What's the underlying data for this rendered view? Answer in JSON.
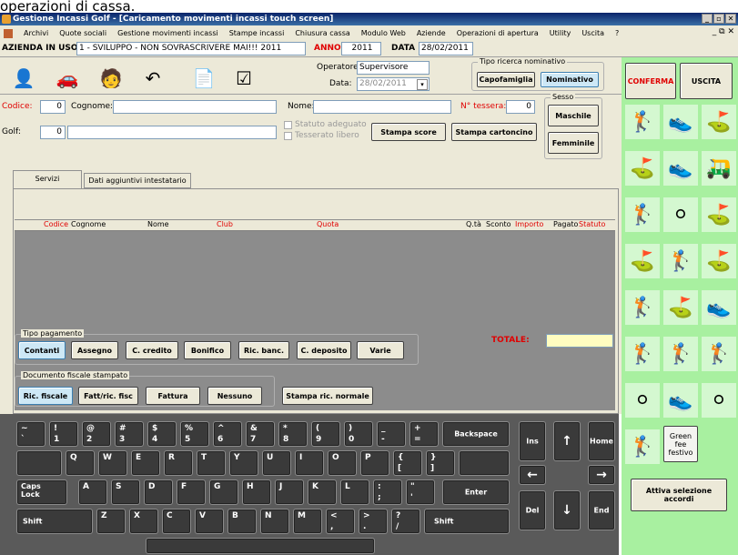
{
  "page_caption": "operazioni di cassa.",
  "window": {
    "title": "Gestione Incassi Golf - [Caricamento movimenti incassi touch screen]"
  },
  "menu": [
    "Archivi",
    "Quote sociali",
    "Gestione movimenti incassi",
    "Stampe incassi",
    "Chiusura cassa",
    "Modulo Web",
    "Aziende",
    "Operazioni di apertura",
    "Utility",
    "Uscita",
    "?"
  ],
  "azienda": {
    "label": "AZIENDA IN USO",
    "value": "1 - SVILUPPO - NON SOVRASCRIVERE MAI!!! 2011",
    "anno_label": "ANNO",
    "anno": "2011",
    "data_label": "DATA",
    "data": "28/02/2011"
  },
  "operatore": {
    "label": "Operatore:",
    "value": "Supervisore",
    "data_label": "Data:",
    "data_value": "28/02/2011"
  },
  "ricerca": {
    "title": "Tipo ricerca nominativo",
    "capofamiglia": "Capofamiglia",
    "nominativo": "Nominativo"
  },
  "actions": {
    "conferma": "CONFERMA",
    "uscita": "USCITA"
  },
  "form": {
    "codice_label": "Codice:",
    "codice": "0",
    "cognome_label": "Cognome:",
    "nome_label": "Nome:",
    "tessera_label": "N° tessera:",
    "tessera": "0",
    "golf_label": "Golf:",
    "golf": "0",
    "statuto": "Statuto adeguato",
    "tesserato": "Tesserato libero",
    "stampa_score": "Stampa score",
    "stampa_cartoncino": "Stampa cartoncino",
    "sesso_title": "Sesso",
    "maschile": "Maschile",
    "femminile": "Femminile"
  },
  "tabs": [
    "Servizi",
    "Dati aggiuntivi intestatario"
  ],
  "table": {
    "columns": [
      "Codice",
      "Cognome",
      "Nome",
      "Club",
      "Quota",
      "Q.tà",
      "Sconto",
      "Importo",
      "Pagato",
      "Statuto"
    ]
  },
  "pagamento": {
    "title": "Tipo pagamento",
    "items": [
      "Contanti",
      "Assegno",
      "C. credito",
      "Bonifico",
      "Ric. banc.",
      "C. deposito",
      "Varie"
    ],
    "totale_label": "TOTALE:"
  },
  "documento": {
    "title": "Documento fiscale stampato",
    "items": [
      "Ric. fiscale",
      "Fatt/ric. fisc",
      "Fattura",
      "Nessuno"
    ],
    "stampa": "Stampa ric. normale"
  },
  "keyboard": {
    "row1": [
      [
        "~",
        "`"
      ],
      [
        "!",
        "1"
      ],
      [
        "@",
        "2"
      ],
      [
        "#",
        "3"
      ],
      [
        "$",
        "4"
      ],
      [
        "%",
        "5"
      ],
      [
        "^",
        "6"
      ],
      [
        "&",
        "7"
      ],
      [
        "*",
        "8"
      ],
      [
        "(",
        "9"
      ],
      [
        ")",
        "0"
      ],
      [
        "_",
        "-"
      ],
      [
        "+",
        "="
      ]
    ],
    "row2": [
      "Q",
      "W",
      "E",
      "R",
      "T",
      "Y",
      "U",
      "I",
      "O",
      "P"
    ],
    "row2b": [
      [
        "{",
        "["
      ],
      [
        "}",
        "]"
      ]
    ],
    "row3": [
      "A",
      "S",
      "D",
      "F",
      "G",
      "H",
      "J",
      "K",
      "L"
    ],
    "row3b": [
      [
        ":",
        ";"
      ],
      [
        "\"",
        "'"
      ]
    ],
    "row4": [
      "Z",
      "X",
      "C",
      "V",
      "B",
      "N",
      "M"
    ],
    "row4b": [
      [
        "<",
        ","
      ],
      [
        ">",
        "."
      ],
      [
        "?",
        "/"
      ]
    ],
    "backspace": "Backspace",
    "caps": "Caps\nLock",
    "enter": "Enter",
    "shift": "Shift",
    "nav": {
      "ins": "Ins",
      "home": "Home",
      "del": "Del",
      "end": "End"
    }
  },
  "right_panel": {
    "green_fee": "Green fee festivo",
    "attiva": "Attiva selezione accordi"
  },
  "colors": {
    "accent_red": "#e00000",
    "selected": "#cde8f6",
    "right_panel": "#a8f0a0",
    "keyboard": "#5a5a5a"
  }
}
